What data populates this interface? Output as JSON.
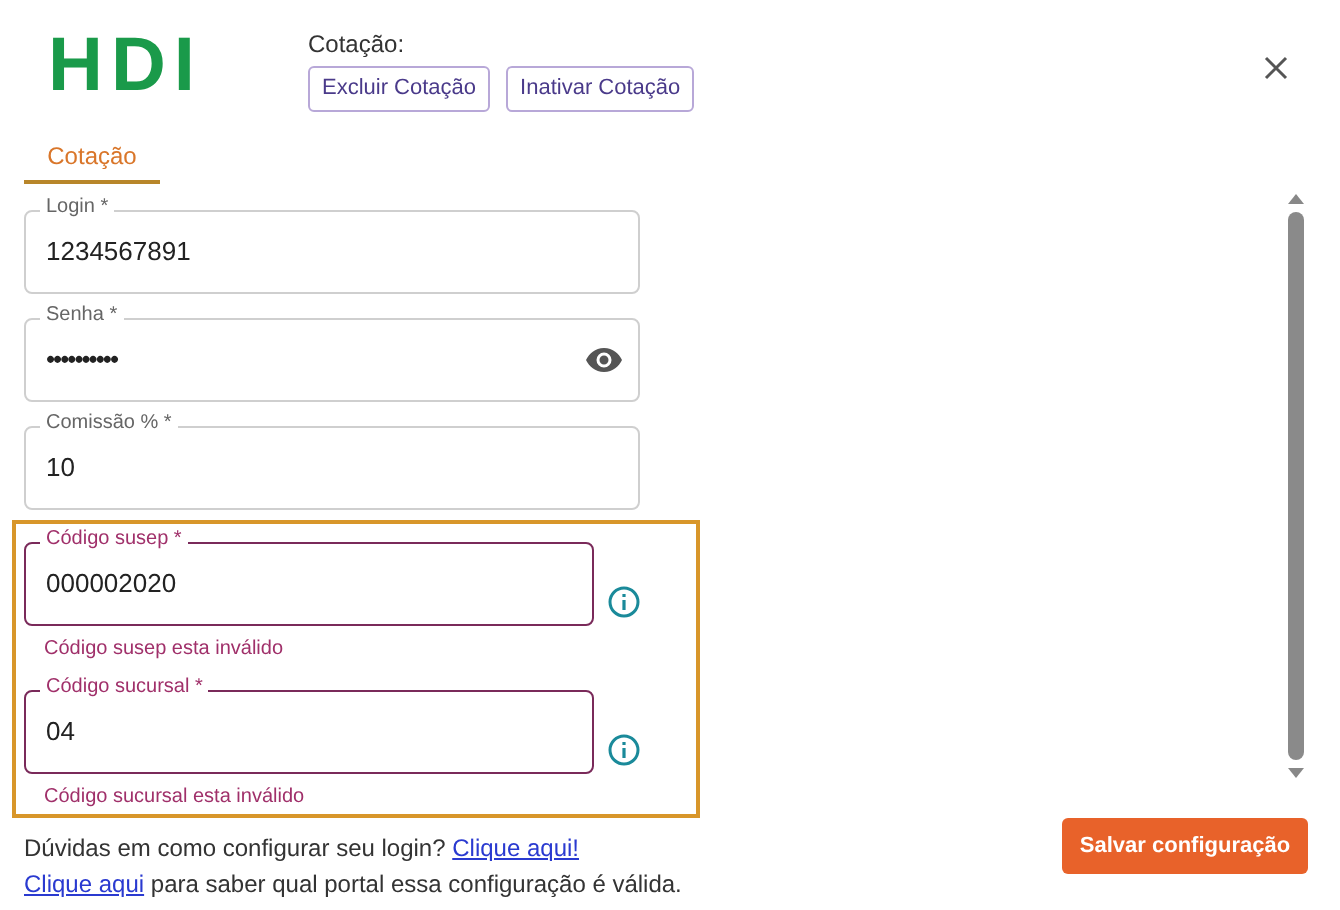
{
  "logo": "HDI",
  "header": {
    "title": "Cotação:",
    "buttons": [
      "Excluir Cotação",
      "Inativar Cotação"
    ]
  },
  "tabs": [
    {
      "label": "Cotação",
      "selected": true
    }
  ],
  "fields": [
    {
      "label": "Login *",
      "value": "1234567891",
      "kind": "text"
    },
    {
      "label": "Senha *",
      "value": "••••••••••",
      "kind": "password"
    },
    {
      "label": "Comissão % *",
      "value": "10",
      "kind": "text"
    }
  ],
  "highlighted_fields": [
    {
      "label": "Código susep *",
      "value": "000002020",
      "error": "Código susep esta inválido"
    },
    {
      "label": "Código sucursal *",
      "value": "04",
      "error": "Código sucursal esta inválido"
    }
  ],
  "help": [
    {
      "kind": "text_then_link",
      "text": "Dúvidas em como configurar seu login?",
      "link": "Clique aqui!"
    },
    {
      "kind": "link_then_text",
      "text": "para saber qual portal essa configuração é válida.",
      "link": "Clique aqui"
    }
  ],
  "save_button": "Salvar configuração"
}
